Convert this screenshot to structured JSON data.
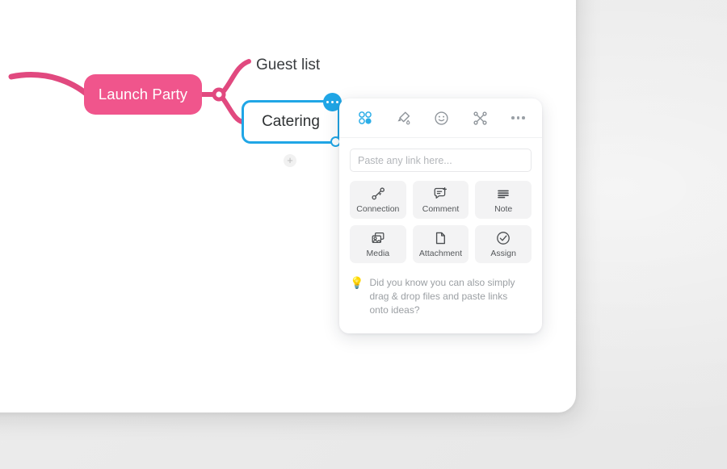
{
  "canvas": {
    "nodes": {
      "root": {
        "label": "Launch Party",
        "color": "#F0558C"
      },
      "branch": {
        "label": "Guest list"
      },
      "selected": {
        "label": "Catering",
        "color": "#20A6E6",
        "badge_icon": "ellipsis-badge",
        "handle_icon": "resize-handle",
        "add_label": "+"
      }
    }
  },
  "panel": {
    "toolbar": [
      {
        "name": "color-palette-icon",
        "title": "Colors"
      },
      {
        "name": "highlighter-icon",
        "title": "Highlight"
      },
      {
        "name": "emoji-icon",
        "title": "Emoji"
      },
      {
        "name": "connect-nodes-icon",
        "title": "Connect"
      },
      {
        "name": "more-options-icon",
        "title": "More"
      }
    ],
    "link_input": {
      "placeholder": "Paste any link here...",
      "value": ""
    },
    "actions": [
      {
        "label": "Connection",
        "icon": "connection-icon"
      },
      {
        "label": "Comment",
        "icon": "comment-plus-icon"
      },
      {
        "label": "Note",
        "icon": "note-lines-icon"
      },
      {
        "label": "Media",
        "icon": "media-images-icon"
      },
      {
        "label": "Attachment",
        "icon": "attachment-file-icon"
      },
      {
        "label": "Assign",
        "icon": "assign-check-icon"
      }
    ],
    "tip": {
      "icon": "lightbulb-icon",
      "emoji": "💡",
      "text": "Did you know you can also simply drag & drop files and paste links onto ideas?"
    }
  }
}
